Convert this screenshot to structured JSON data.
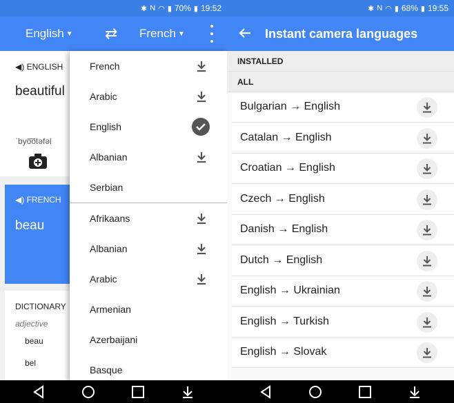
{
  "left": {
    "status": {
      "battery": "70%",
      "time": "19:52"
    },
    "header": {
      "source_lang": "English",
      "target_lang": "French"
    },
    "source_card": {
      "label": "ENGLISH",
      "word": "beautiful",
      "phonetic": "ˈbyo͞otəfəl"
    },
    "target_card": {
      "label": "FRENCH",
      "word": "beau"
    },
    "dictionary": {
      "heading": "DICTIONARY",
      "pos": "adjective",
      "entries": [
        "beau",
        "bel"
      ]
    },
    "dropdown": {
      "items": [
        {
          "label": "French",
          "state": "download"
        },
        {
          "label": "Arabic",
          "state": "download"
        },
        {
          "label": "English",
          "state": "installed"
        },
        {
          "label": "Albanian",
          "state": "download"
        },
        {
          "label": "Serbian",
          "state": "none"
        },
        {
          "label": "Afrikaans",
          "state": "download"
        },
        {
          "label": "Albanian",
          "state": "download"
        },
        {
          "label": "Arabic",
          "state": "download"
        },
        {
          "label": "Armenian",
          "state": "none"
        },
        {
          "label": "Azerbaijani",
          "state": "none"
        },
        {
          "label": "Basque",
          "state": "none"
        }
      ]
    }
  },
  "right": {
    "status": {
      "battery": "68%",
      "time": "19:55"
    },
    "header": {
      "title": "Instant camera languages"
    },
    "sections": {
      "installed": "INSTALLED",
      "all": "ALL"
    },
    "rows": [
      "Bulgarian → English",
      "Catalan → English",
      "Croatian → English",
      "Czech → English",
      "Danish → English",
      "Dutch → English",
      "English → Ukrainian",
      "English → Turkish",
      "English → Slovak"
    ]
  },
  "colors": {
    "appbar": "#4285f4",
    "statusbar": "#3b80e6",
    "accent_card": "#4285f4"
  },
  "icons": [
    "bluetooth-icon",
    "nfc-icon",
    "wifi-icon",
    "signal-icon",
    "battery-icon",
    "swap-icon",
    "more-vert-icon",
    "speaker-icon",
    "camera-icon",
    "download-icon",
    "check-icon",
    "back-arrow-icon",
    "nav-back-icon",
    "nav-home-icon",
    "nav-recents-icon",
    "nav-notifications-icon"
  ]
}
